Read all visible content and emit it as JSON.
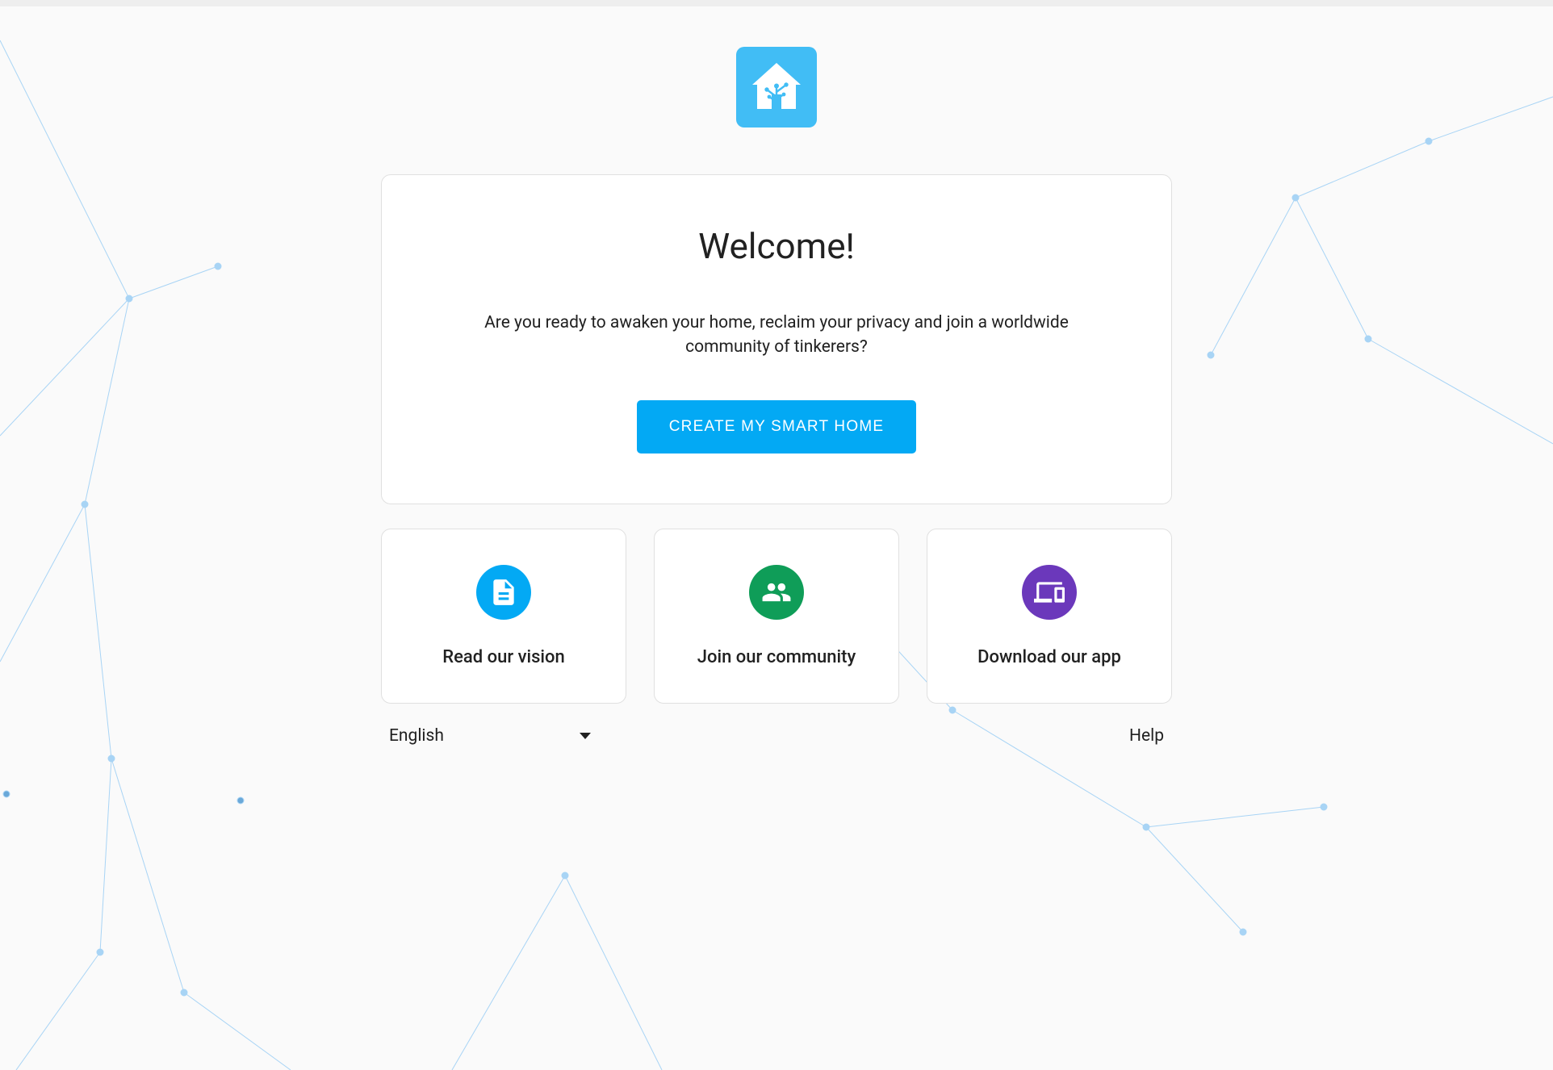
{
  "welcome": {
    "title": "Welcome!",
    "description": "Are you ready to awaken your home, reclaim your privacy and join a worldwide community of tinkerers?",
    "cta": "CREATE MY SMART HOME"
  },
  "cards": [
    {
      "label": "Read our vision",
      "icon": "document-icon",
      "color": "blue"
    },
    {
      "label": "Join our community",
      "icon": "users-icon",
      "color": "green"
    },
    {
      "label": "Download our app",
      "icon": "devices-icon",
      "color": "purple"
    }
  ],
  "footer": {
    "language": "English",
    "help": "Help"
  }
}
